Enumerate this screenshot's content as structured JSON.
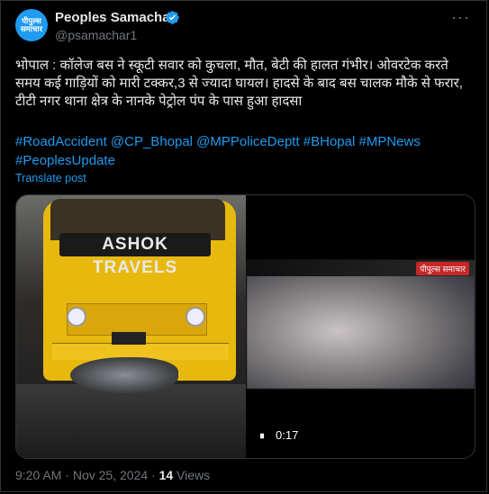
{
  "author": {
    "avatar_text": "पीपुल्स समाचार",
    "name": "Peoples Samachar",
    "handle": "@psamachar1"
  },
  "post": {
    "text": "भोपाल : कॉलेज बस ने स्कूटी सवार को कुचला, मौत, बेटी की हालत गंभीर। ओवरटेक करते समय कई गाड़ियों को मारी टक्कर,3 से ज्यादा घायल। हादसे के बाद बस चालक मौके से फरार, टीटी नगर थाना क्षेत्र के नानके पेट्रोल पंप के पास हुआ हादसा",
    "hashtags": "#RoadAccident @CP_Bhopal @MPPoliceDeptt #BHopal #MPNews #PeoplesUpdate",
    "translate_label": "Translate post"
  },
  "media": {
    "bus_sign": "ASHOK TRAVELS",
    "watermark": "पीपुल्स समाचार",
    "play_icon": "⏸",
    "duration": "0:17"
  },
  "meta": {
    "time": "9:20 AM",
    "date": "Nov 25, 2024",
    "views_count": "14",
    "views_label": "Views"
  },
  "colors": {
    "link": "#1d9bf0",
    "background": "#000000"
  }
}
